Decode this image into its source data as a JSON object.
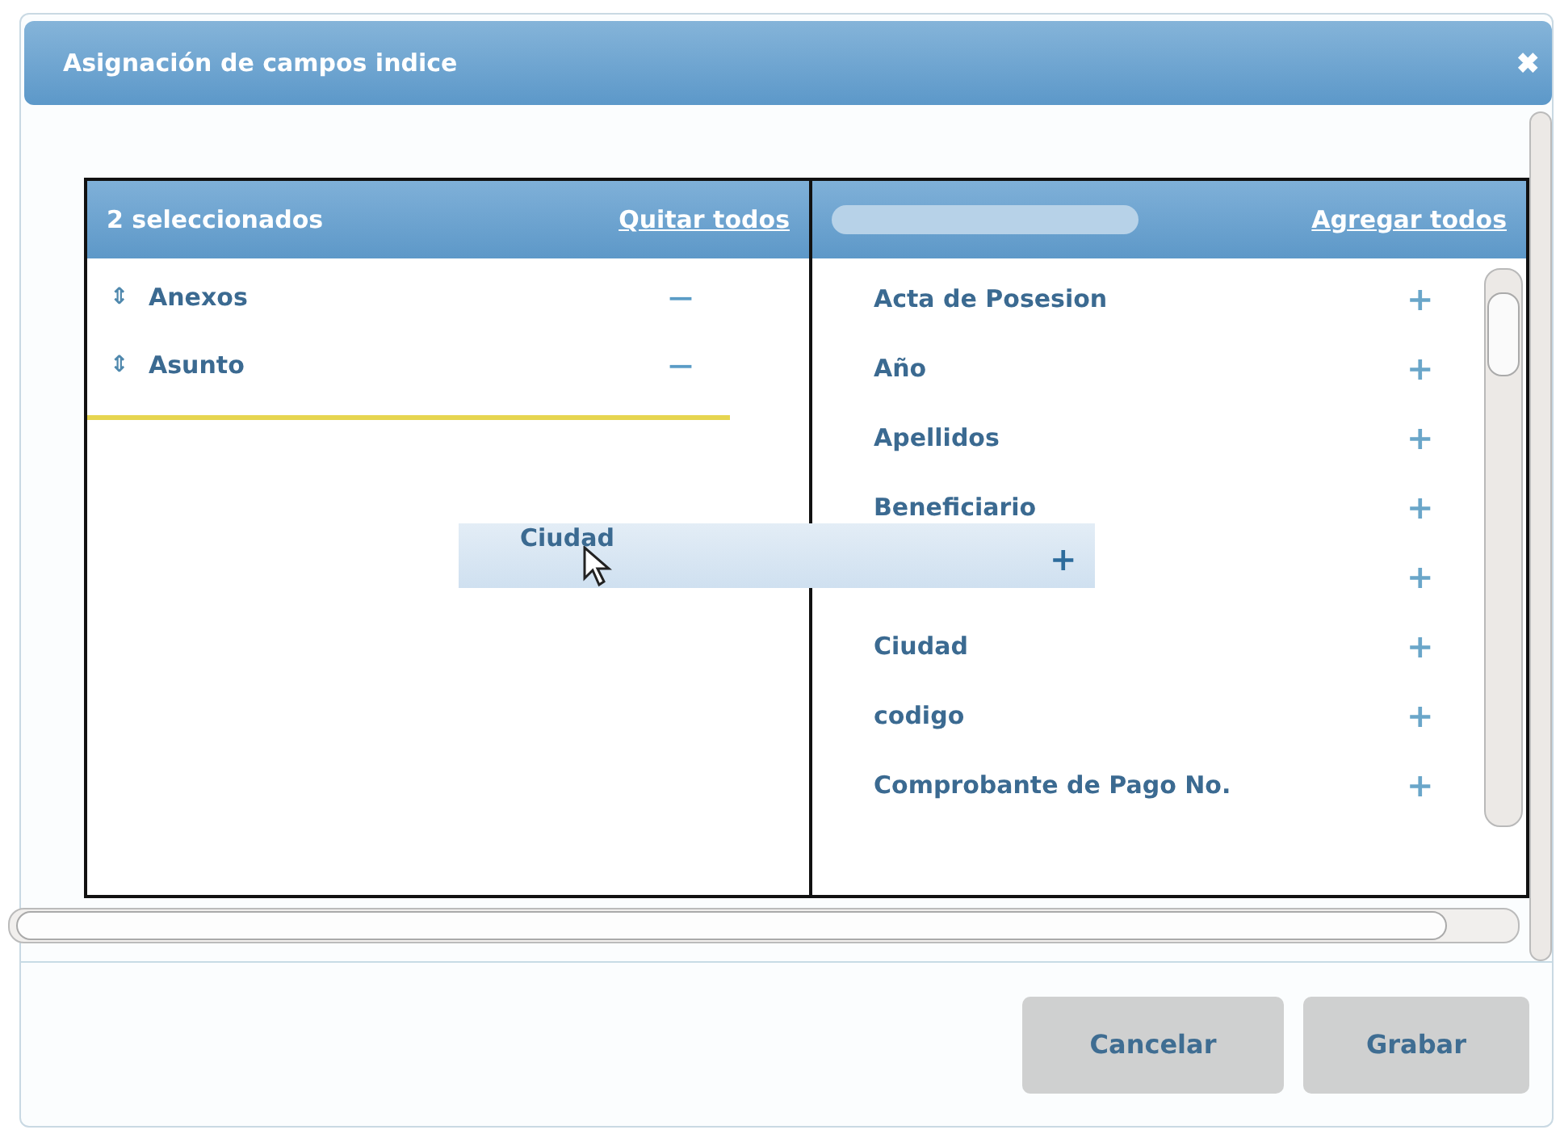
{
  "window": {
    "title": "Asignación de campos indice",
    "close": "✖"
  },
  "selected_panel": {
    "count_label": "2 seleccionados",
    "remove_all": "Quitar todos",
    "items": [
      {
        "label": "Anexos",
        "handle": "⇕",
        "remove": "—"
      },
      {
        "label": "Asunto",
        "handle": "⇕",
        "remove": "—"
      }
    ]
  },
  "available_panel": {
    "add_all": "Agregar todos",
    "items": [
      {
        "label": "Acta de Posesion",
        "add": "+"
      },
      {
        "label": "Año",
        "add": "+"
      },
      {
        "label": "Apellidos",
        "add": "+"
      },
      {
        "label": "Beneficiario",
        "add": "+"
      },
      {
        "add": "+"
      },
      {
        "label": "Ciudad",
        "add": "+"
      },
      {
        "label": "codigo",
        "add": "+"
      },
      {
        "label": "Comprobante de Pago No.",
        "add": "+"
      }
    ]
  },
  "drag_item": {
    "label": "Ciudad",
    "add": "+"
  },
  "buttons": [
    "Cancelar",
    "Grabar"
  ]
}
